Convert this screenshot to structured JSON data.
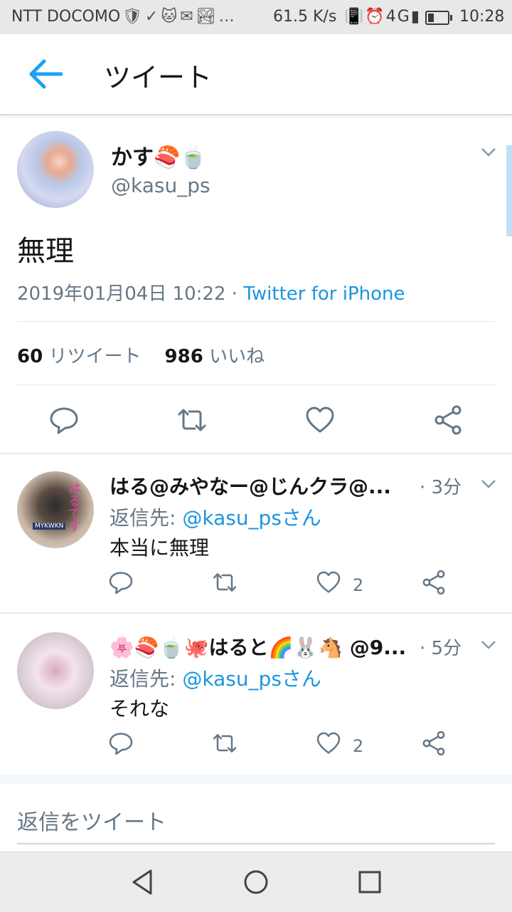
{
  "status_bar": {
    "carrier": "NTT DOCOMO",
    "notification_icons": "🛡✓🐱✉🏞…",
    "speed": "61.5 K/s",
    "system_icons": "📳⏰4G▮",
    "time": "10:28"
  },
  "app_bar": {
    "title": "ツイート"
  },
  "tweet": {
    "display_name": "かす🍣🍵",
    "handle": "@kasu_ps",
    "text": "無理",
    "date": "2019年01月04日 10:22",
    "separator": " · ",
    "source": "Twitter for iPhone",
    "retweet_count": "60",
    "retweet_label": "リツイート",
    "like_count": "986",
    "like_label": "いいね"
  },
  "replies": [
    {
      "display_name": "はる@みやなー@じんクラ@...",
      "time": "· 3分",
      "reply_to_prefix": "返信先: ",
      "reply_to_handle": "@kasu_psさん",
      "text": "本当に無理",
      "like_count": "2",
      "avatar_tag": "MYKWKN",
      "avatar_text": "はるです"
    },
    {
      "display_name": "🌸🍣🍵🐙はると🌈🐰🐴 @9...",
      "time": "· 5分",
      "reply_to_prefix": "返信先: ",
      "reply_to_handle": "@kasu_psさん",
      "text": "それな",
      "like_count": "2"
    }
  ],
  "composer": {
    "placeholder": "返信をツイート"
  },
  "colors": {
    "accent": "#1b95e0",
    "secondary_text": "#657786",
    "primary_text": "#14171a",
    "divider": "#e1e8ed"
  }
}
